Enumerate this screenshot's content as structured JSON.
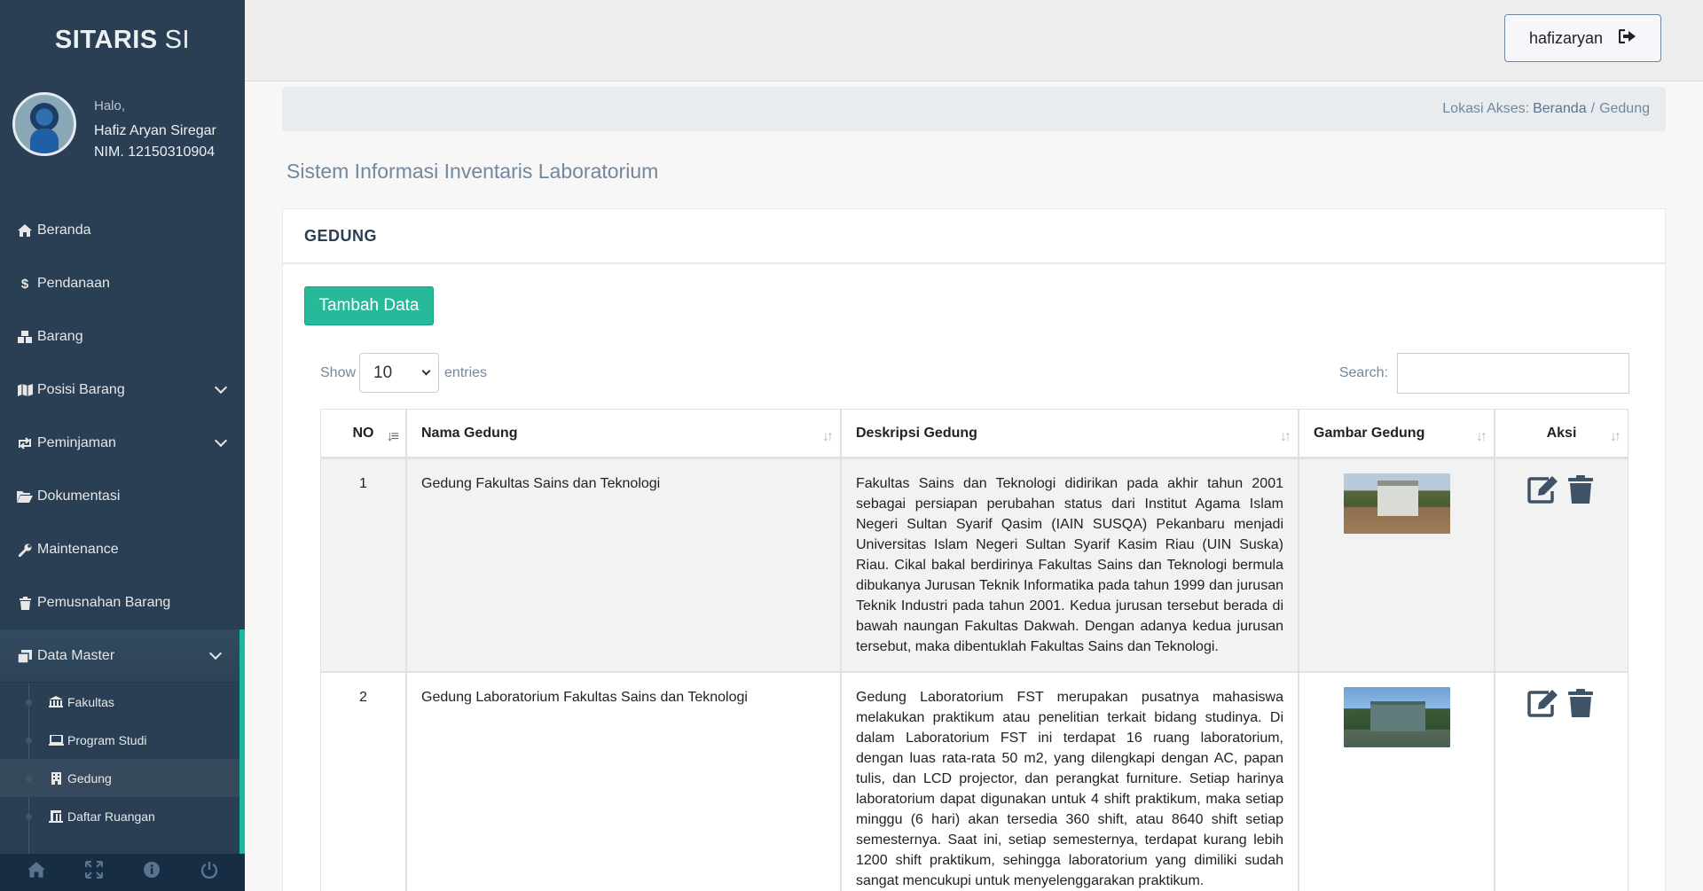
{
  "brand": {
    "bold": "SITARIS",
    "lite": "SI"
  },
  "profile": {
    "greeting": "Halo,",
    "name": "Hafiz Aryan Siregar",
    "nim": "NIM. 12150310904"
  },
  "menu": [
    {
      "label": "Beranda",
      "icon": "home-icon"
    },
    {
      "label": "Pendanaan",
      "icon": "dollar-icon"
    },
    {
      "label": "Barang",
      "icon": "cubes-icon"
    },
    {
      "label": "Posisi Barang",
      "icon": "map-icon"
    },
    {
      "label": "Peminjaman",
      "icon": "retweet-icon"
    },
    {
      "label": "Dokumentasi",
      "icon": "folder-open-icon"
    },
    {
      "label": "Maintenance",
      "icon": "wrench-icon"
    },
    {
      "label": "Pemusnahan Barang",
      "icon": "trash-icon"
    },
    {
      "label": "Data Master",
      "icon": "clone-icon"
    }
  ],
  "submenu": [
    {
      "label": "Fakultas",
      "icon": "university-icon"
    },
    {
      "label": "Program Studi",
      "icon": "laptop-icon"
    },
    {
      "label": "Gedung",
      "icon": "building-icon"
    },
    {
      "label": "Daftar Ruangan",
      "icon": "bank-icon"
    }
  ],
  "topnav": {
    "username": "hafizaryan"
  },
  "breadcrumb": {
    "prefix": "Lokasi Akses:",
    "home": "Beranda",
    "current": "Gedung",
    "separator": "/"
  },
  "page_title": "Sistem Informasi Inventaris Laboratorium",
  "panel": {
    "title": "GEDUNG",
    "add_button": "Tambah Data"
  },
  "datatable": {
    "show_label": "Show",
    "entries_value": "10",
    "entries_label": "entries",
    "search_label": "Search:",
    "columns": [
      "NO",
      "Nama Gedung",
      "Deskripsi Gedung",
      "Gambar Gedung",
      "Aksi"
    ],
    "rows": [
      {
        "no": "1",
        "nama": "Gedung Fakultas Sains dan Teknologi",
        "deskripsi": "Fakultas Sains dan Teknologi didirikan pada akhir tahun 2001 sebagai persiapan perubahan status dari Institut Agama Islam Negeri Sultan Syarif Qasim (IAIN SUSQA) Pekanbaru menjadi Universitas Islam Negeri Sultan Syarif Kasim Riau (UIN Suska) Riau. Cikal bakal berdirinya Fakultas Sains dan Teknologi bermula dibukanya Jurusan Teknik Informatika pada tahun 1999 dan jurusan Teknik Industri pada tahun 2001. Kedua jurusan tersebut berada di bawah naungan Fakultas Dakwah. Dengan adanya kedua jurusan tersebut, maka dibentuklah Fakultas Sains dan Teknologi."
      },
      {
        "no": "2",
        "nama": "Gedung Laboratorium Fakultas Sains dan Teknologi",
        "deskripsi": "Gedung Laboratorium FST merupakan pusatnya mahasiswa melakukan praktikum atau penelitian terkait bidang studinya. Di dalam Laboratorium FST ini terdapat 16 ruang laboratorium, dengan luas rata-rata 50 m2, yang dilengkapi dengan AC, papan tulis, dan LCD projector, dan perangkat furniture. Setiap harinya laboratorium dapat digunakan untuk 4 shift praktikum, maka setiap minggu (6 hari) akan tersedia 360 shift, atau 8640 shift setiap semesternya. Saat ini, setiap semesternya, terdapat kurang lebih 1200 shift praktikum, sehingga laboratorium yang dimiliki sudah sangat mencukupi untuk menyelenggarakan praktikum."
      }
    ]
  },
  "colors": {
    "sidebar": "#2a3f54",
    "accent": "#1abb9c",
    "button": "#26b99a",
    "action_icon": "#3f5366"
  }
}
